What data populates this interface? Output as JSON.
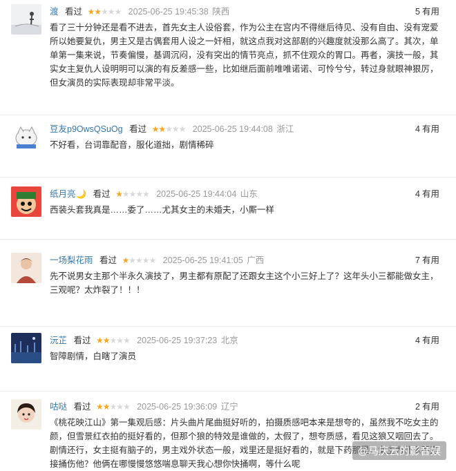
{
  "vote_unit": "有用",
  "seen_label": "看过",
  "comments": [
    {
      "user": "渡",
      "stars": 2,
      "time": "2025-06-25 19:45:38",
      "location": "陕西",
      "votes": "5",
      "text": "看了三十分钟还是看不进去，首先女主人设俗套，作为公主在宫内不得继后待见、没有自由、没有宠爱所以她要复仇，男主又是古偶套用人设之一奸相，就这点我对这部剧的兴趣度就没那么高了。其次，单单第一集来说，节奏偏慢，基调沉闷，没有突出的情节亮点，抓不住观众的胃口。再者，演技一般，其实女主复仇人设明明可以演的有反差感一些，比如继后面前唯唯诺诺、可怜兮兮，转过身就眼神狠厉，但女演员的实际表现却非常平淡。"
    },
    {
      "user": "豆友p9OwsQSuOg",
      "stars": 2,
      "time": "2025-06-25 19:44:08",
      "location": "浙江",
      "votes": "4",
      "text": "不好看，台词靠配音，服化道拙，剧情稀碎"
    },
    {
      "user": "纸月亮🌙",
      "stars": 1,
      "time": "2025-06-25 19:44:04",
      "location": "山东",
      "votes": "4",
      "text": "西装头套我真是……委了……尤其女主的未婚夫，小厮一样"
    },
    {
      "user": "一场梨花雨",
      "stars": 1,
      "time": "2025-06-25 19:41:05",
      "location": "广西",
      "votes": "7",
      "text": "先不说男女主那个半永久演技了，男主都有原配了还跟女主这个小三好上了？这年头小三都能做女主，三观呢？太炸裂了！！！"
    },
    {
      "user": "沅芷",
      "stars": 2,
      "time": "2025-06-25 19:37:23",
      "location": "北京",
      "votes": "4",
      "text": "智障剧情，白瞎了演员"
    },
    {
      "user": "咕哒",
      "stars": 2,
      "time": "2025-06-25 19:36:09",
      "location": "辽宁",
      "votes": "2",
      "text": "《桃花映江山》第一集观后感：片头曲片尾曲挺好听的，拍摄质感吧本来是想夸的，虽然我不吃女主的颜，但雪景红衣拍的挺好看的，但那个狼的特效是谁做的，太假了，想夸质感，看见这狼又咽回去了。剧情还行，女主挺有脑子的，男主戏外状态一般，戏里还是挺好看的，就是下药那里，女主为什么不直接捅伤他？他俩在哪慢慢悠悠喘息聊天我心想你快捅啊，等什么呢"
    }
  ],
  "watermark": "@马庆云的影音娱"
}
